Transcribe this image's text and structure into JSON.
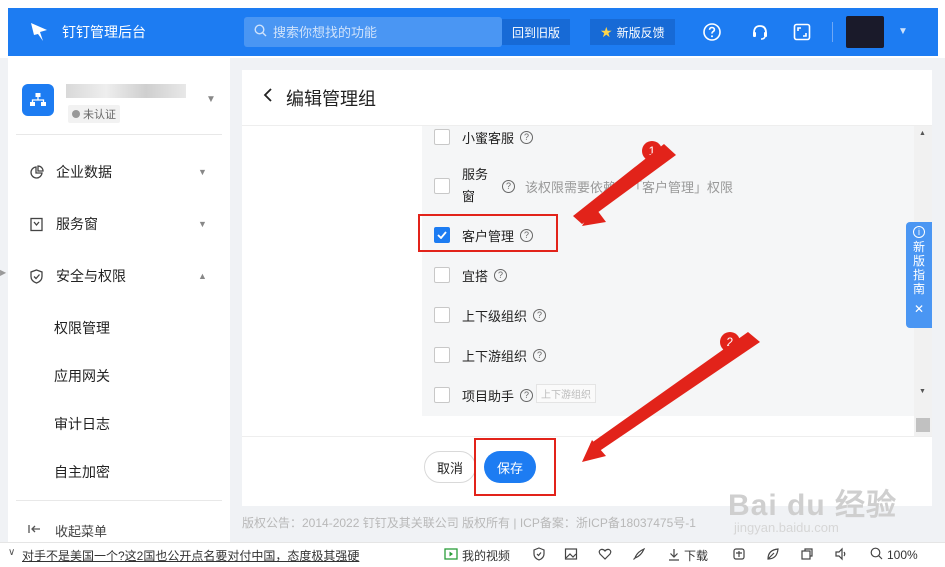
{
  "topbar": {
    "app_title": "钉钉管理后台",
    "search_placeholder": "搜索你想找的功能",
    "back_old_label": "回到旧版",
    "new_feedback_label": "新版反馈"
  },
  "sidebar": {
    "org_badge": "未认证",
    "menu": [
      {
        "label": "企业数据",
        "icon": "pie-chart-icon"
      },
      {
        "label": "服务窗",
        "icon": "service-window-icon"
      },
      {
        "label": "安全与权限",
        "icon": "shield-icon"
      }
    ],
    "sub_items": [
      "权限管理",
      "应用网关",
      "审计日志",
      "自主加密"
    ],
    "collapse_label": "收起菜单"
  },
  "main": {
    "title": "编辑管理组",
    "permissions": [
      {
        "label": "小蜜客服",
        "checked": false
      },
      {
        "label": "服务窗",
        "checked": false,
        "hint": "该权限需要依赖于「客户管理」权限"
      },
      {
        "label": "客户管理",
        "checked": true
      },
      {
        "label": "宜搭",
        "checked": false
      },
      {
        "label": "上下级组织",
        "checked": false
      },
      {
        "label": "上下游组织",
        "checked": false
      },
      {
        "label": "项目助手",
        "checked": false
      }
    ],
    "service_label_line1": "服务",
    "service_label_line2": "窗",
    "tooltip_ghost": "上下游组织",
    "cancel_label": "取消",
    "save_label": "保存"
  },
  "annotations": {
    "step1": "1",
    "step2": "2",
    "color": "#e2231a"
  },
  "guide": {
    "chars": [
      "新",
      "版",
      "指",
      "南"
    ],
    "close": "✕"
  },
  "copyright": "版权公告：2014-2022 钉钉及其关联公司 版权所有 | ICP备案：浙ICP备18037475号-1",
  "watermark": {
    "main": "Bai du 经验",
    "sub": "jingyan.baidu.com"
  },
  "statusbar": {
    "news": "对手不是美国一个?这2国也公开点名要对付中国，态度极其强硬",
    "video_label": "我的视频",
    "download_label": "下载",
    "zoom": "100%"
  },
  "colors": {
    "primary": "#1d7cf2",
    "annotation": "#e2231a"
  }
}
